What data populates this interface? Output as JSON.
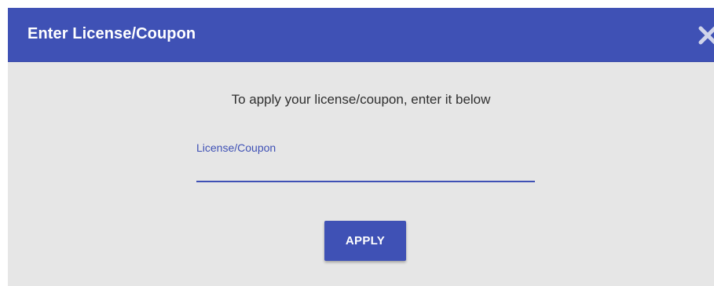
{
  "dialog": {
    "title": "Enter License/Coupon",
    "instruction": "To apply your license/coupon, enter it below",
    "field": {
      "label": "License/Coupon",
      "value": "",
      "placeholder": ""
    },
    "apply_label": "APPLY",
    "close_icon": "close-icon"
  },
  "colors": {
    "primary": "#3f51b5",
    "body_background": "#e6e6e6",
    "header_text": "#ffffff"
  }
}
